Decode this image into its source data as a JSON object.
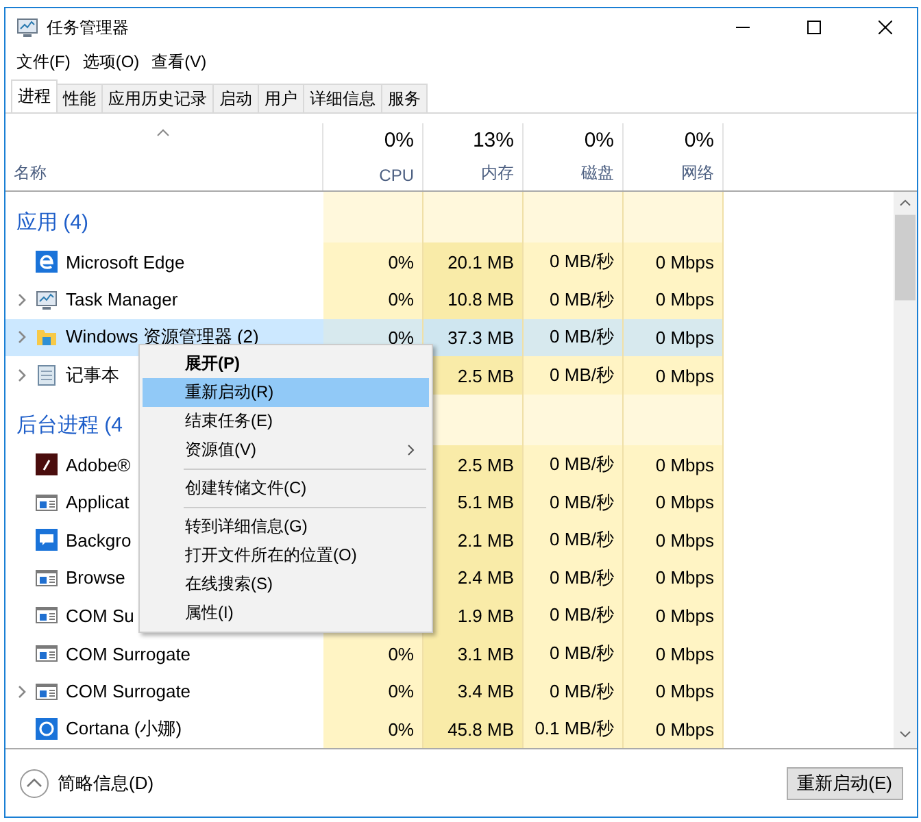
{
  "window": {
    "title": "任务管理器"
  },
  "menu_bar": [
    "文件(F)",
    "选项(O)",
    "查看(V)"
  ],
  "tabs": [
    {
      "label": "进程",
      "selected": true
    },
    {
      "label": "性能",
      "selected": false
    },
    {
      "label": "应用历史记录",
      "selected": false
    },
    {
      "label": "启动",
      "selected": false
    },
    {
      "label": "用户",
      "selected": false
    },
    {
      "label": "详细信息",
      "selected": false
    },
    {
      "label": "服务",
      "selected": false
    }
  ],
  "columns": [
    {
      "label": "名称"
    },
    {
      "usage": "0%",
      "label": "CPU"
    },
    {
      "usage": "13%",
      "label": "内存"
    },
    {
      "usage": "0%",
      "label": "磁盘"
    },
    {
      "usage": "0%",
      "label": "网络"
    }
  ],
  "rows": [
    {
      "kind": "group",
      "name": "应用 (4)"
    },
    {
      "kind": "process",
      "expandable": false,
      "selected": false,
      "name": "Microsoft Edge",
      "cpu": "0%",
      "memory": "20.1 MB",
      "disk": "0 MB/秒",
      "network": "0 Mbps"
    },
    {
      "kind": "process",
      "expandable": true,
      "selected": false,
      "name": "Task Manager",
      "cpu": "0%",
      "memory": "10.8 MB",
      "disk": "0 MB/秒",
      "network": "0 Mbps"
    },
    {
      "kind": "process",
      "expandable": true,
      "selected": true,
      "name": "Windows 资源管理器 (2)",
      "cpu": "0%",
      "memory": "37.3 MB",
      "disk": "0 MB/秒",
      "network": "0 Mbps"
    },
    {
      "kind": "process",
      "expandable": true,
      "selected": false,
      "name": "记事本",
      "memory": "2.5 MB",
      "disk": "0 MB/秒",
      "network": "0 Mbps"
    },
    {
      "kind": "group",
      "name": "后台进程 (4"
    },
    {
      "kind": "process",
      "expandable": false,
      "selected": false,
      "name": "Adobe®",
      "memory": "2.5 MB",
      "disk": "0 MB/秒",
      "network": "0 Mbps"
    },
    {
      "kind": "process",
      "expandable": false,
      "selected": false,
      "name": "Applicat",
      "memory": "5.1 MB",
      "disk": "0 MB/秒",
      "network": "0 Mbps"
    },
    {
      "kind": "process",
      "expandable": false,
      "selected": false,
      "name": "Backgro",
      "memory": "2.1 MB",
      "disk": "0 MB/秒",
      "network": "0 Mbps"
    },
    {
      "kind": "process",
      "expandable": false,
      "selected": false,
      "name": "Browse",
      "memory": "2.4 MB",
      "disk": "0 MB/秒",
      "network": "0 Mbps"
    },
    {
      "kind": "process",
      "expandable": false,
      "selected": false,
      "name": "COM Su",
      "memory": "1.9 MB",
      "disk": "0 MB/秒",
      "network": "0 Mbps"
    },
    {
      "kind": "process",
      "expandable": false,
      "selected": false,
      "name": "COM Surrogate",
      "cpu": "0%",
      "memory": "3.1 MB",
      "disk": "0 MB/秒",
      "network": "0 Mbps"
    },
    {
      "kind": "process",
      "expandable": true,
      "selected": false,
      "name": "COM Surrogate",
      "cpu": "0%",
      "memory": "3.4 MB",
      "disk": "0 MB/秒",
      "network": "0 Mbps"
    },
    {
      "kind": "process",
      "expandable": false,
      "selected": false,
      "name": "Cortana (小娜)",
      "cpu": "0%",
      "memory": "45.8 MB",
      "disk": "0.1 MB/秒",
      "network": "0 Mbps"
    }
  ],
  "context_menu": [
    {
      "kind": "item",
      "label": "展开(P)",
      "bold": true,
      "selected": false,
      "submenu": false
    },
    {
      "kind": "item",
      "label": "重新启动(R)",
      "bold": false,
      "selected": true,
      "submenu": false
    },
    {
      "kind": "item",
      "label": "结束任务(E)",
      "bold": false,
      "selected": false,
      "submenu": false
    },
    {
      "kind": "item",
      "label": "资源值(V)",
      "bold": false,
      "selected": false,
      "submenu": true
    },
    {
      "kind": "separator"
    },
    {
      "kind": "item",
      "label": "创建转储文件(C)",
      "bold": false,
      "selected": false,
      "submenu": false
    },
    {
      "kind": "separator"
    },
    {
      "kind": "item",
      "label": "转到详细信息(G)",
      "bold": false,
      "selected": false,
      "submenu": false
    },
    {
      "kind": "item",
      "label": "打开文件所在的位置(O)",
      "bold": false,
      "selected": false,
      "submenu": false
    },
    {
      "kind": "item",
      "label": "在线搜索(S)",
      "bold": false,
      "selected": false,
      "submenu": false
    },
    {
      "kind": "item",
      "label": "属性(I)",
      "bold": false,
      "selected": false,
      "submenu": false
    }
  ],
  "footer": {
    "details_link": "简略信息(D)",
    "action_button": "重新启动(E)"
  }
}
